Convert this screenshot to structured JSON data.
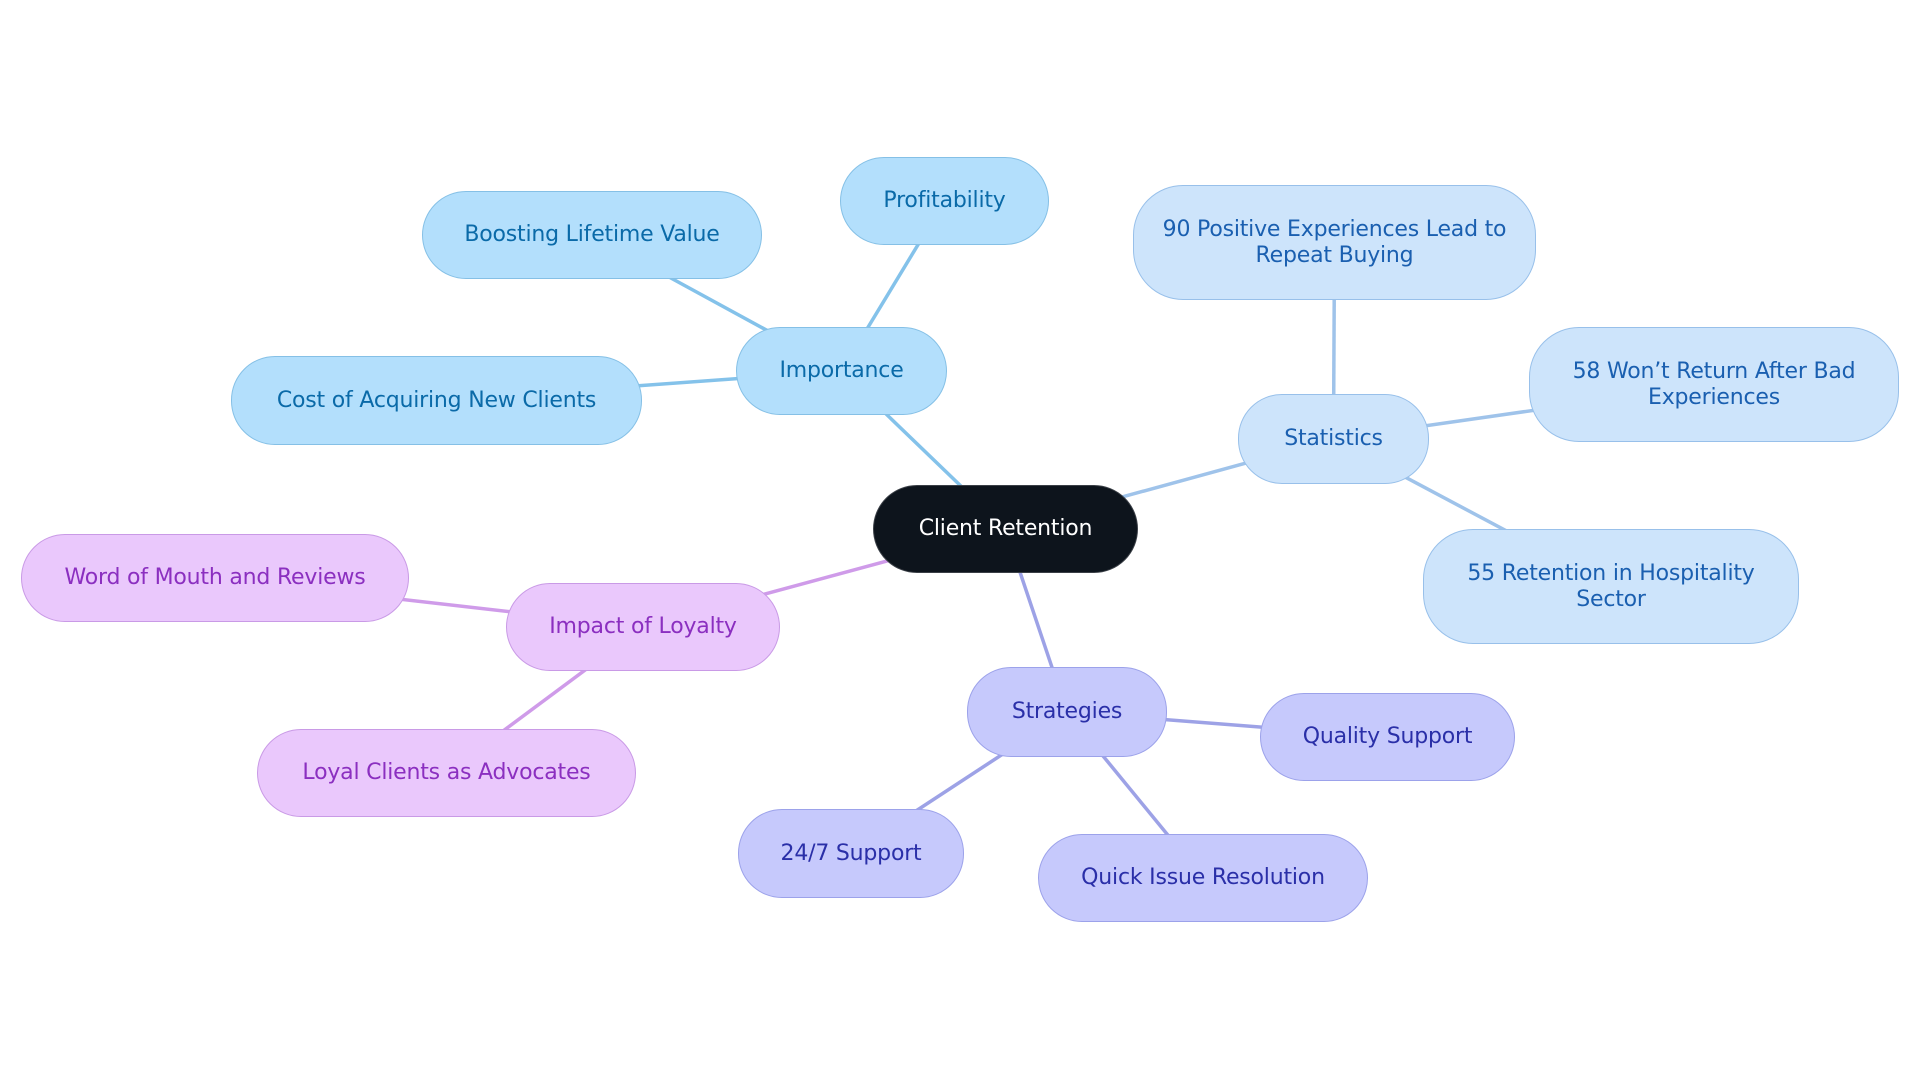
{
  "diagram": {
    "type": "mindmap",
    "root": {
      "id": "root",
      "label": "Client Retention"
    },
    "colors": {
      "importance_edge": "#84c2ea",
      "statistics_edge": "#9fc3ea",
      "loyalty_edge": "#cf9be9",
      "strategies_edge": "#9da2e6",
      "root_fill": "#0d141c"
    },
    "branches": [
      {
        "id": "importance",
        "label": "Importance",
        "theme": "t-imp",
        "children": [
          {
            "id": "profitability",
            "label": "Profitability"
          },
          {
            "id": "boosting",
            "label": "Boosting Lifetime Value"
          },
          {
            "id": "cost",
            "label": "Cost of Acquiring New Clients"
          }
        ]
      },
      {
        "id": "statistics",
        "label": "Statistics",
        "theme": "t-stat",
        "children": [
          {
            "id": "stat90",
            "label": "90 Positive Experiences Lead to Repeat Buying"
          },
          {
            "id": "stat58",
            "label": "58 Won’t Return After Bad Experiences"
          },
          {
            "id": "stat55",
            "label": "55 Retention in Hospitality Sector"
          }
        ]
      },
      {
        "id": "loyalty",
        "label": "Impact of Loyalty",
        "theme": "t-loy",
        "children": [
          {
            "id": "wom",
            "label": "Word of Mouth and Reviews"
          },
          {
            "id": "advocates",
            "label": "Loyal Clients as Advocates"
          }
        ]
      },
      {
        "id": "strategies",
        "label": "Strategies",
        "theme": "t-str",
        "children": [
          {
            "id": "quality",
            "label": "Quality Support"
          },
          {
            "id": "support247",
            "label": "24/7 Support"
          },
          {
            "id": "quick",
            "label": "Quick Issue Resolution"
          }
        ]
      }
    ]
  }
}
